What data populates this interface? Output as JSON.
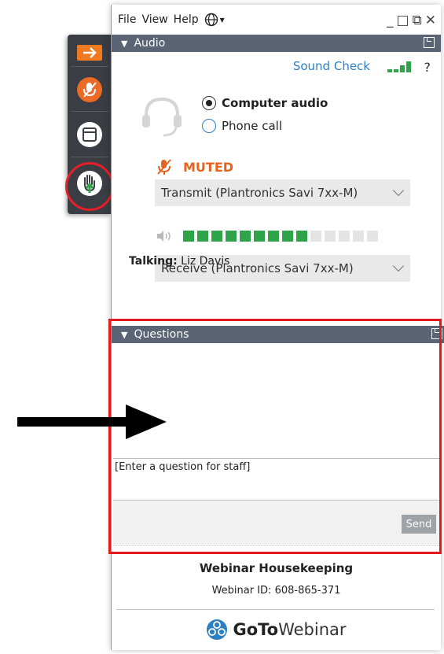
{
  "menu": {
    "file": "File",
    "view": "View",
    "help": "Help"
  },
  "window_controls": {
    "minimize": "_",
    "restore": "□",
    "popout": "⧉",
    "close": "✕"
  },
  "audio_panel": {
    "title": "Audio",
    "sound_check": "Sound Check",
    "help": "?",
    "options": [
      "Computer audio",
      "Phone call"
    ],
    "selected_option": "Computer audio",
    "status": "MUTED",
    "transmit_device": "Transmit (Plantronics Savi 7xx-M)",
    "receive_device": "Receive (Plantronics Savi 7xx-M)",
    "volume_level": {
      "active_segments": 9,
      "total_segments": 14
    },
    "talking_label": "Talking:",
    "talking_name": "Liz Davis"
  },
  "questions_panel": {
    "title": "Questions",
    "input_placeholder": "[Enter a question for staff]",
    "send_label": "Send"
  },
  "footer": {
    "title": "Webinar Housekeeping",
    "webinar_id": "Webinar ID: 608-865-371",
    "brand_bold": "GoTo",
    "brand_regular": "Webinar"
  },
  "colors": {
    "panel_header": "#5a6475",
    "accent_orange": "#e7621f",
    "meter_green": "#2ea34a",
    "highlight_red": "#e21b1f",
    "link_blue": "#2f7fc3"
  },
  "icons": [
    "arrow-right-icon",
    "muted-mic-icon",
    "window-icon",
    "raise-hand-icon",
    "globe-icon",
    "headset-icon",
    "speaker-icon",
    "gotowebinar-logo-icon"
  ]
}
